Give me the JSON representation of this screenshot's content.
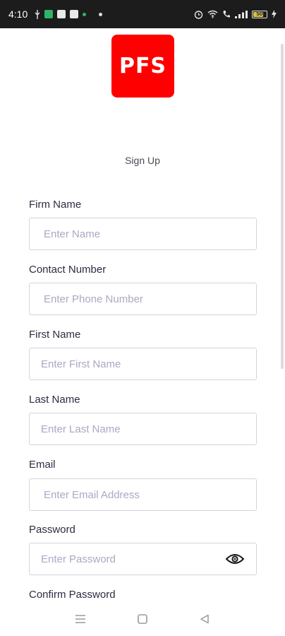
{
  "status_bar": {
    "time": "4:10",
    "battery_level": "50"
  },
  "logo": {
    "text": "PFS",
    "color": "#ff0000"
  },
  "page": {
    "title": "Sign Up"
  },
  "form": {
    "firm_name": {
      "label": "Firm Name",
      "placeholder": "Enter Name"
    },
    "contact_number": {
      "label": "Contact Number",
      "placeholder": "Enter Phone Number"
    },
    "first_name": {
      "label": "First Name",
      "placeholder": "Enter First Name"
    },
    "last_name": {
      "label": "Last Name",
      "placeholder": "Enter Last Name"
    },
    "email": {
      "label": "Email",
      "placeholder": "Enter Email Address"
    },
    "password": {
      "label": "Password",
      "placeholder": "Enter Password"
    },
    "confirm_password": {
      "label": "Confirm Password"
    }
  },
  "icons": {
    "password_toggle": "eye-icon",
    "nav_menu": "menu-icon",
    "nav_home": "home-square-icon",
    "nav_back": "back-triangle-icon"
  }
}
